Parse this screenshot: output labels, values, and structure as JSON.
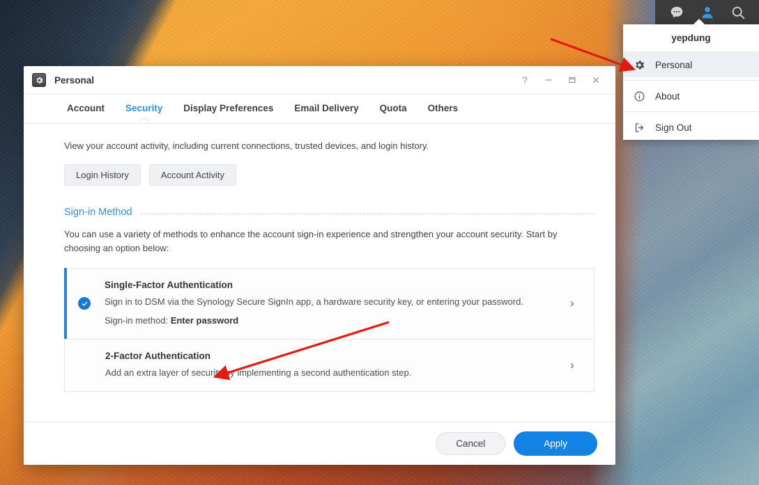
{
  "taskbar": {
    "icons": [
      {
        "name": "chat-icon",
        "glyph": "chat"
      },
      {
        "name": "user-icon",
        "glyph": "user"
      },
      {
        "name": "search-icon",
        "glyph": "search"
      }
    ]
  },
  "user_menu": {
    "username": "yepdung",
    "items": [
      {
        "label": "Personal",
        "icon": "gear-icon",
        "active": true
      },
      {
        "label": "About",
        "icon": "info-icon",
        "active": false
      },
      {
        "label": "Sign Out",
        "icon": "sign-out-icon",
        "active": false
      }
    ]
  },
  "dialog": {
    "title": "Personal",
    "icon": "gear-icon",
    "window_controls": {
      "help": "?",
      "minimize": "—",
      "maximize": "❐",
      "close": "✕"
    },
    "tabs": [
      {
        "label": "Account",
        "active": false
      },
      {
        "label": "Security",
        "active": true
      },
      {
        "label": "Display Preferences",
        "active": false
      },
      {
        "label": "Email Delivery",
        "active": false
      },
      {
        "label": "Quota",
        "active": false
      },
      {
        "label": "Others",
        "active": false
      }
    ],
    "lead_text": "View your account activity, including current connections, trusted devices, and login history.",
    "buttons": [
      {
        "label": "Login History"
      },
      {
        "label": "Account Activity"
      }
    ],
    "section": {
      "title": "Sign-in Method",
      "description": "You can use a variety of methods to enhance the account sign-in experience and strengthen your account security. Start by choosing an option below:"
    },
    "options": [
      {
        "title": "Single-Factor Authentication",
        "description": "Sign in to DSM via the Synology Secure SignIn app, a hardware security key, or entering your password.",
        "detail_label": "Sign-in method:",
        "detail_value": "Enter password",
        "selected": true,
        "chevron": "›"
      },
      {
        "title": "2-Factor Authentication",
        "description": "Add an extra layer of security by implementing a second authentication step.",
        "detail_label": "",
        "detail_value": "",
        "selected": false,
        "chevron": "›"
      }
    ],
    "footer": {
      "cancel_label": "Cancel",
      "apply_label": "Apply"
    }
  },
  "colors": {
    "accent_blue": "#2f8fe0",
    "apply_blue": "#1283e2",
    "card_accent": "#2f7fd0",
    "annotation_red": "#e01b0f",
    "taskbar_bg": "#3b3b3b"
  }
}
